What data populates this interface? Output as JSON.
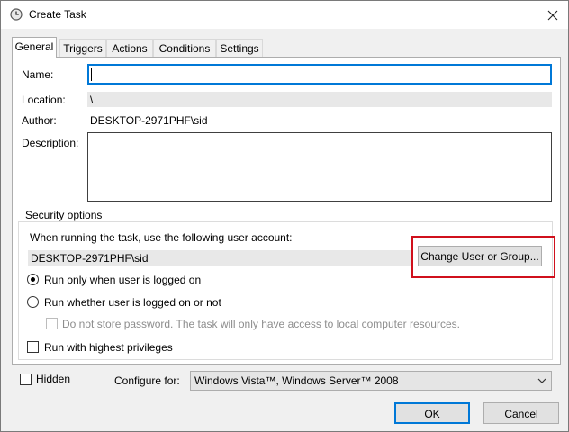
{
  "window": {
    "title": "Create Task",
    "title_icon": "clock-icon",
    "close_icon": "close-icon"
  },
  "tabs": [
    {
      "label": "General",
      "active": true
    },
    {
      "label": "Triggers",
      "active": false
    },
    {
      "label": "Actions",
      "active": false
    },
    {
      "label": "Conditions",
      "active": false
    },
    {
      "label": "Settings",
      "active": false
    }
  ],
  "general": {
    "name_label": "Name:",
    "name_value": "",
    "location_label": "Location:",
    "location_value": "\\",
    "author_label": "Author:",
    "author_value": "DESKTOP-2971PHF\\sid",
    "description_label": "Description:",
    "description_value": ""
  },
  "security": {
    "group_title": "Security options",
    "account_prompt": "When running the task, use the following user account:",
    "account_value": "DESKTOP-2971PHF\\sid",
    "change_button": "Change User or Group...",
    "radio_logged_on": "Run only when user is logged on",
    "radio_logged_on_selected": true,
    "radio_whether": "Run whether user is logged on or not",
    "no_store_password": "Do not store password.  The task will only have access to local computer resources.",
    "highest_privileges": "Run with highest privileges"
  },
  "bottom": {
    "hidden_label": "Hidden",
    "configure_label": "Configure for:",
    "configure_value": "Windows Vista™, Windows Server™ 2008",
    "ok_label": "OK",
    "cancel_label": "Cancel"
  },
  "colors": {
    "highlight": "#d0101c",
    "focus": "#0078d7"
  }
}
